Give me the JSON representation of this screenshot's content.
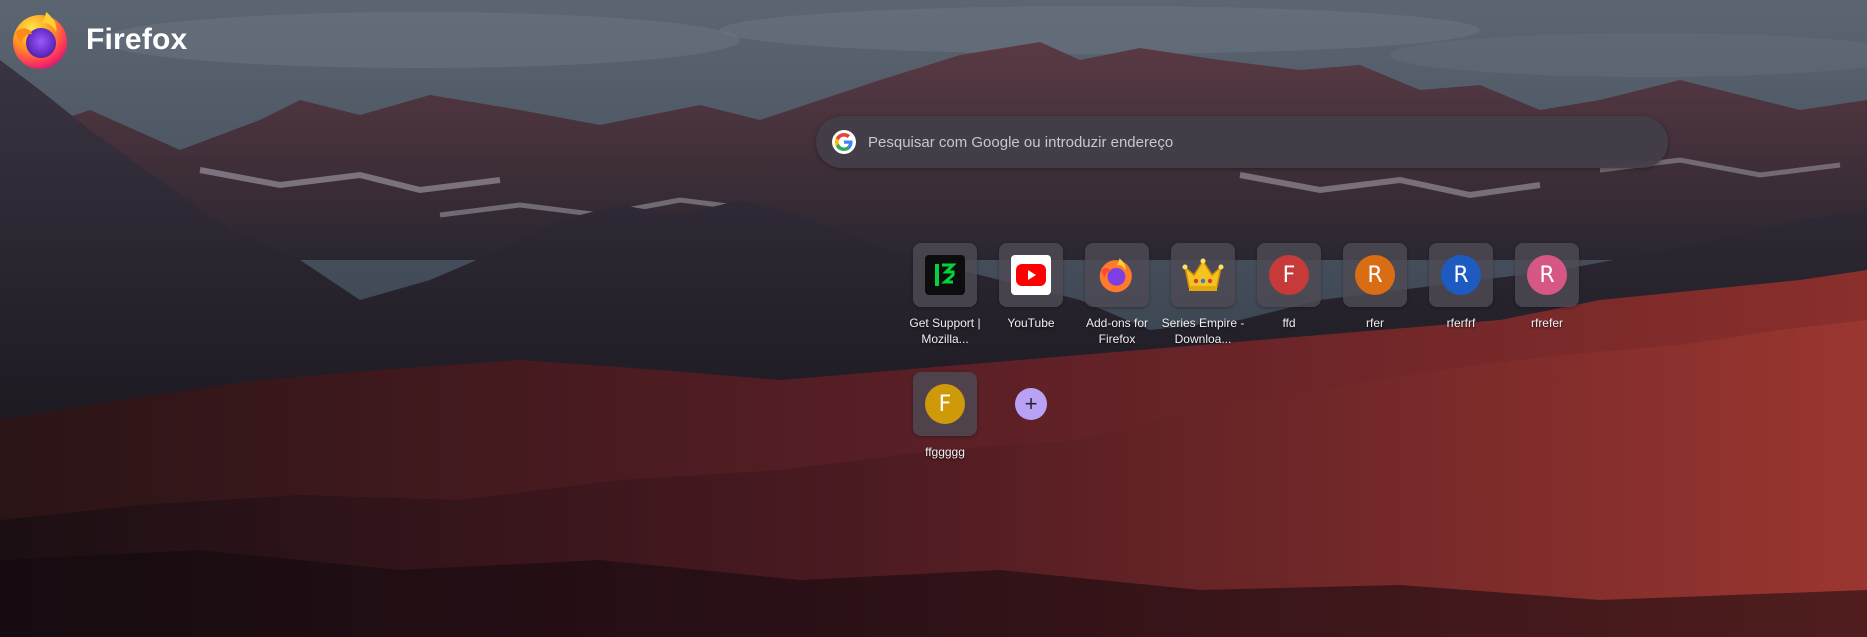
{
  "brand": {
    "name": "Firefox",
    "logo_icon": "firefox-logo-icon"
  },
  "search": {
    "placeholder": "Pesquisar com Google ou introduzir endereço",
    "engine_icon": "google-icon"
  },
  "shortcuts": [
    {
      "label": "Get Support | Mozilla...",
      "icon": "mozilla-support-icon",
      "bg": "#0d0d0d",
      "fg": "#00d43a"
    },
    {
      "label": "YouTube",
      "icon": "youtube-icon",
      "bg": "#ffffff",
      "fg": "#ff0000"
    },
    {
      "label": "Add-ons for Firefox",
      "icon": "firefox-icon"
    },
    {
      "label": "Series Empire - Downloa...",
      "icon": "crown-icon"
    },
    {
      "label": "ffd",
      "letter": "F",
      "color": "#c63b39"
    },
    {
      "label": "rfer",
      "letter": "R",
      "color": "#d96d14"
    },
    {
      "label": "rferfrf",
      "letter": "R",
      "color": "#1e5bc0"
    },
    {
      "label": "rfrefer",
      "letter": "R",
      "color": "#d65784"
    },
    {
      "label": "ffggggg",
      "letter": "F",
      "color": "#cf9a0a"
    }
  ],
  "add_shortcut": {
    "glyph": "+",
    "icon": "plus-icon"
  }
}
